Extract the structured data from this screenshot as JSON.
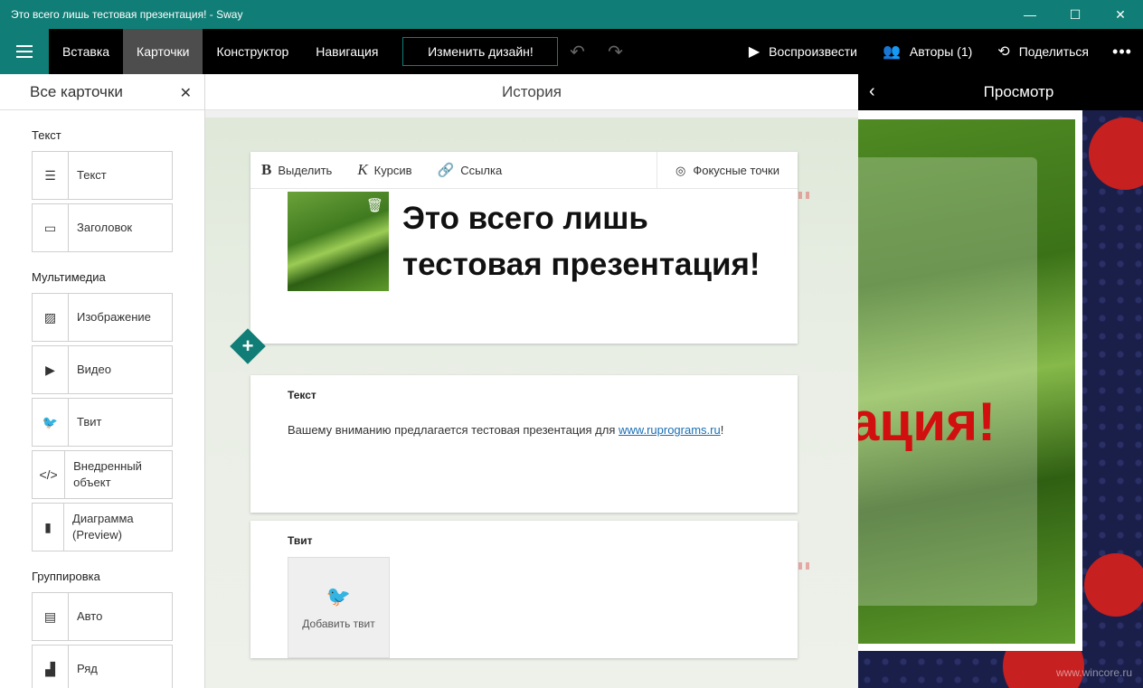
{
  "window": {
    "title": "Это всего лишь тестовая презентация! - Sway",
    "minimize": "—",
    "maximize": "☐",
    "close": "✕"
  },
  "ribbon": {
    "tabs": [
      {
        "label": "Вставка",
        "active": false
      },
      {
        "label": "Карточки",
        "active": true
      },
      {
        "label": "Конструктор",
        "active": false
      },
      {
        "label": "Навигация",
        "active": false
      }
    ],
    "design_button": "Изменить дизайн!",
    "play": "Воспроизвести",
    "authors": "Авторы (1)",
    "share": "Поделиться",
    "more": "•••"
  },
  "left_panel": {
    "title": "Все карточки",
    "close": "✕",
    "groups": [
      {
        "label": "Текст",
        "items": [
          {
            "icon": "text-lines-icon",
            "glyph": "☰",
            "label": "Текст"
          },
          {
            "icon": "heading-icon",
            "glyph": "▭",
            "label": "Заголовок"
          }
        ]
      },
      {
        "label": "Мультимедиа",
        "items": [
          {
            "icon": "image-icon",
            "glyph": "▨",
            "label": "Изображение"
          },
          {
            "icon": "video-play-icon",
            "glyph": "▶",
            "label": "Видео"
          },
          {
            "icon": "twitter-bird-icon",
            "glyph": "🐦",
            "label": "Твит"
          },
          {
            "icon": "embed-code-icon",
            "glyph": "</>",
            "label": "Внедренный объект"
          },
          {
            "icon": "bar-chart-icon",
            "glyph": "▮",
            "label": "Диаграмма (Preview)"
          }
        ]
      },
      {
        "label": "Группировка",
        "items": [
          {
            "icon": "auto-group-icon",
            "glyph": "▤",
            "label": "Авто"
          },
          {
            "icon": "row-stack-icon",
            "glyph": "▟",
            "label": "Ряд"
          }
        ]
      }
    ]
  },
  "story": {
    "title": "История",
    "toolbar": {
      "bold": "Выделить",
      "italic": "Курсив",
      "link": "Ссылка",
      "focus": "Фокусные точки"
    },
    "title_card": {
      "text": "Это всего лишь тестовая презентация!"
    },
    "text_card": {
      "caption": "Текст",
      "body_prefix": "Вашему вниманию предлагается тестовая презентация для ",
      "link": "www.ruprograms.ru",
      "body_suffix": "!"
    },
    "tweet_card": {
      "caption": "Твит",
      "add_label": "Добавить твит"
    }
  },
  "preview": {
    "title": "Просмотр",
    "big_text": "ация!",
    "watermark": "www.wincore.ru"
  },
  "colors": {
    "accent": "#107e76",
    "ribbon": "#000000",
    "preview_red": "#d20f0f"
  }
}
